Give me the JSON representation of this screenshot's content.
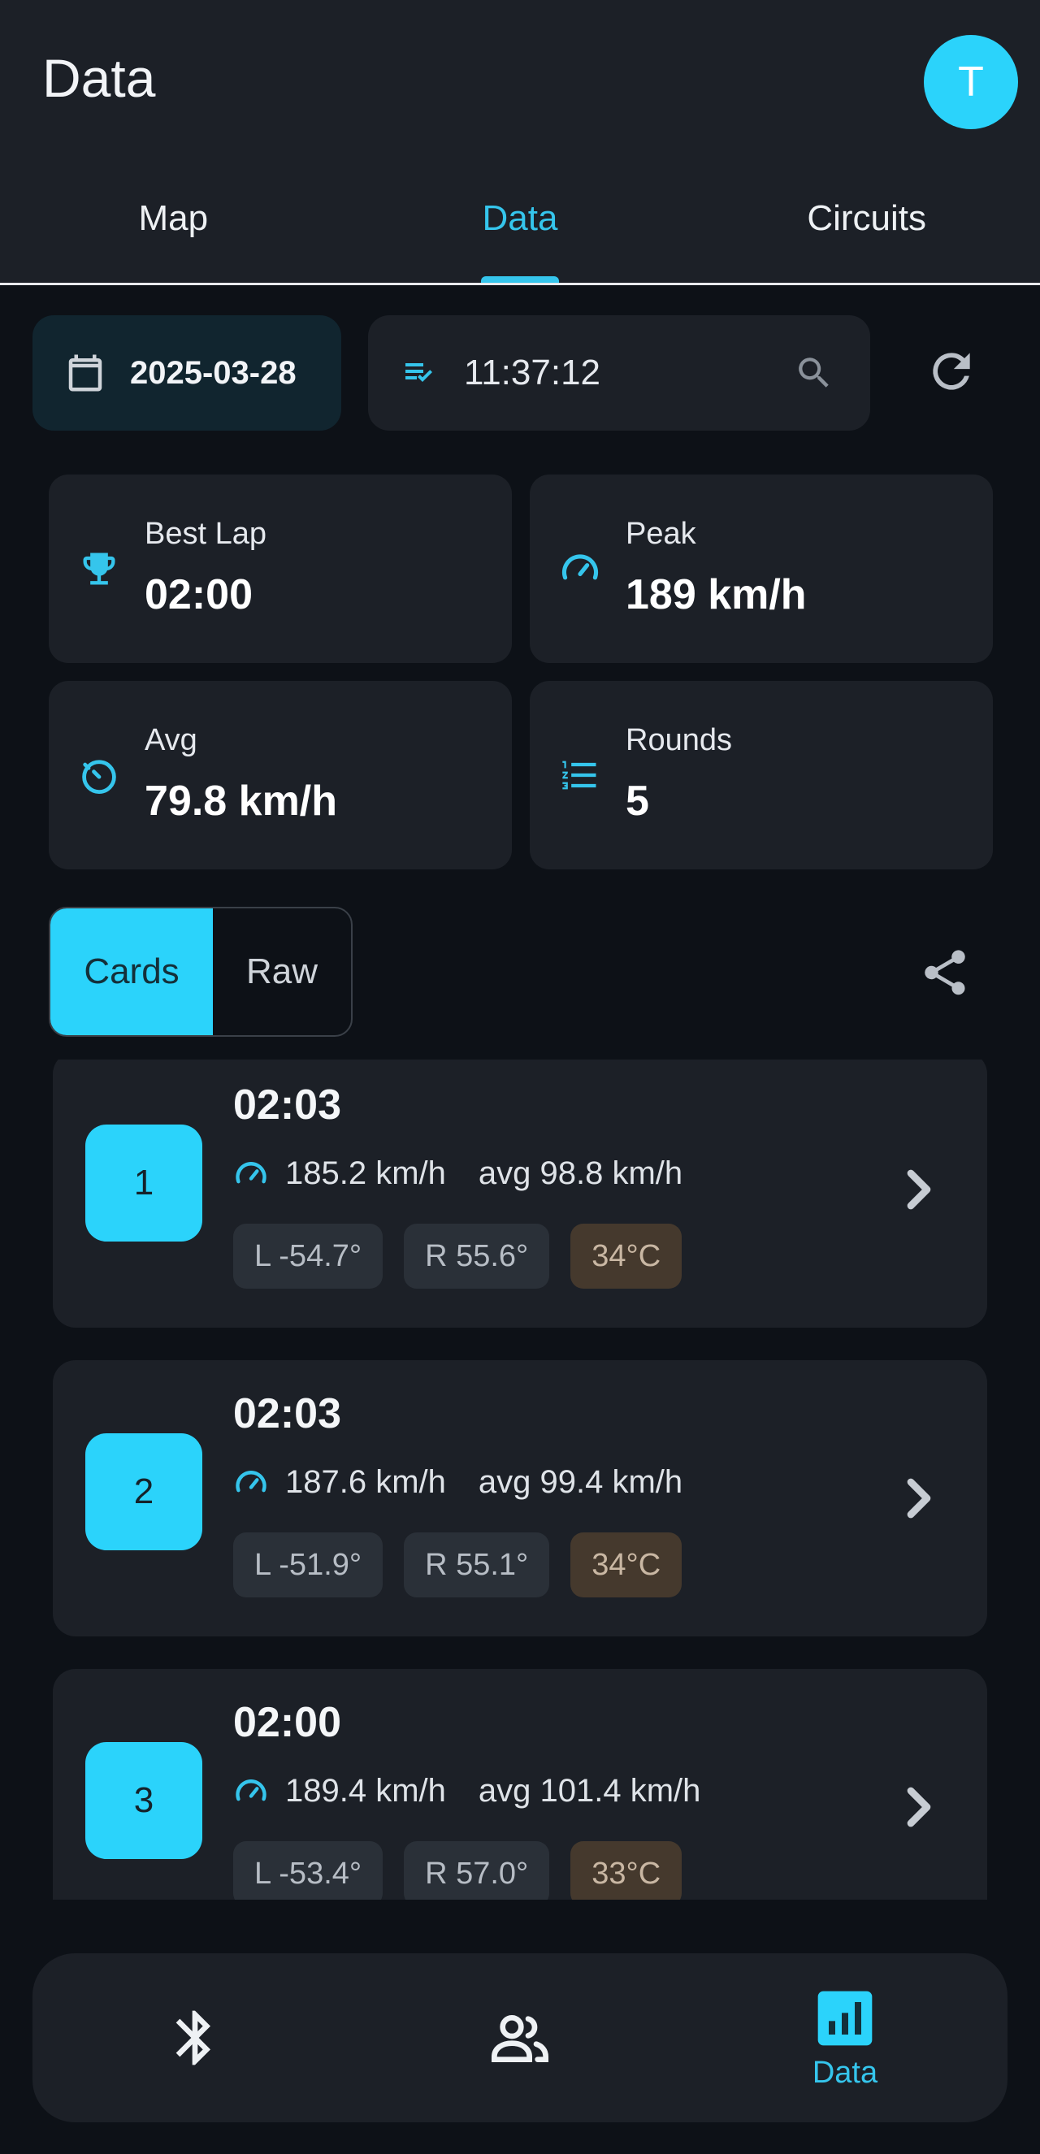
{
  "app": {
    "title": "Data",
    "avatar_letter": "T"
  },
  "tabs": [
    {
      "label": "Map"
    },
    {
      "label": "Data",
      "active": true
    },
    {
      "label": "Circuits"
    }
  ],
  "filters": {
    "date": "2025-03-28",
    "session_time": "11:37:12",
    "icons": {
      "date": "calendar-icon",
      "session": "playlist-check-icon",
      "search": "search-icon",
      "refresh": "refresh-icon"
    }
  },
  "stats": {
    "best_lap": {
      "label": "Best Lap",
      "value": "02:00",
      "icon": "trophy-icon"
    },
    "peak": {
      "label": "Peak",
      "value": "189 km/h",
      "icon": "speedometer-icon"
    },
    "avg": {
      "label": "Avg",
      "value": "79.8 km/h",
      "icon": "timer-icon"
    },
    "rounds": {
      "label": "Rounds",
      "value": "5",
      "icon": "numbered-list-icon"
    }
  },
  "view_toggle": {
    "cards": "Cards",
    "raw": "Raw",
    "selected": "Cards"
  },
  "laps": [
    {
      "number": "1",
      "time": "02:03",
      "peak": "185.2 km/h",
      "avg": "avg 98.8 km/h",
      "lean_left": "L -54.7°",
      "lean_right": "R 55.6°",
      "temp": "34°C"
    },
    {
      "number": "2",
      "time": "02:03",
      "peak": "187.6 km/h",
      "avg": "avg 99.4 km/h",
      "lean_left": "L -51.9°",
      "lean_right": "R 55.1°",
      "temp": "34°C"
    },
    {
      "number": "3",
      "time": "02:00",
      "peak": "189.4 km/h",
      "avg": "avg 101.4 km/h",
      "lean_left": "L -53.4°",
      "lean_right": "R 57.0°",
      "temp": "33°C"
    }
  ],
  "bottom_nav": {
    "items": [
      {
        "icon": "bluetooth-icon"
      },
      {
        "icon": "people-icon"
      },
      {
        "icon": "bar-chart-icon",
        "label": "Data",
        "active": true
      }
    ]
  },
  "colors": {
    "accent": "#2bd3fb",
    "accent_text": "#35c5ec",
    "background": "#0d1117",
    "surface": "#1c2027",
    "temp_chip": "#45392d"
  }
}
